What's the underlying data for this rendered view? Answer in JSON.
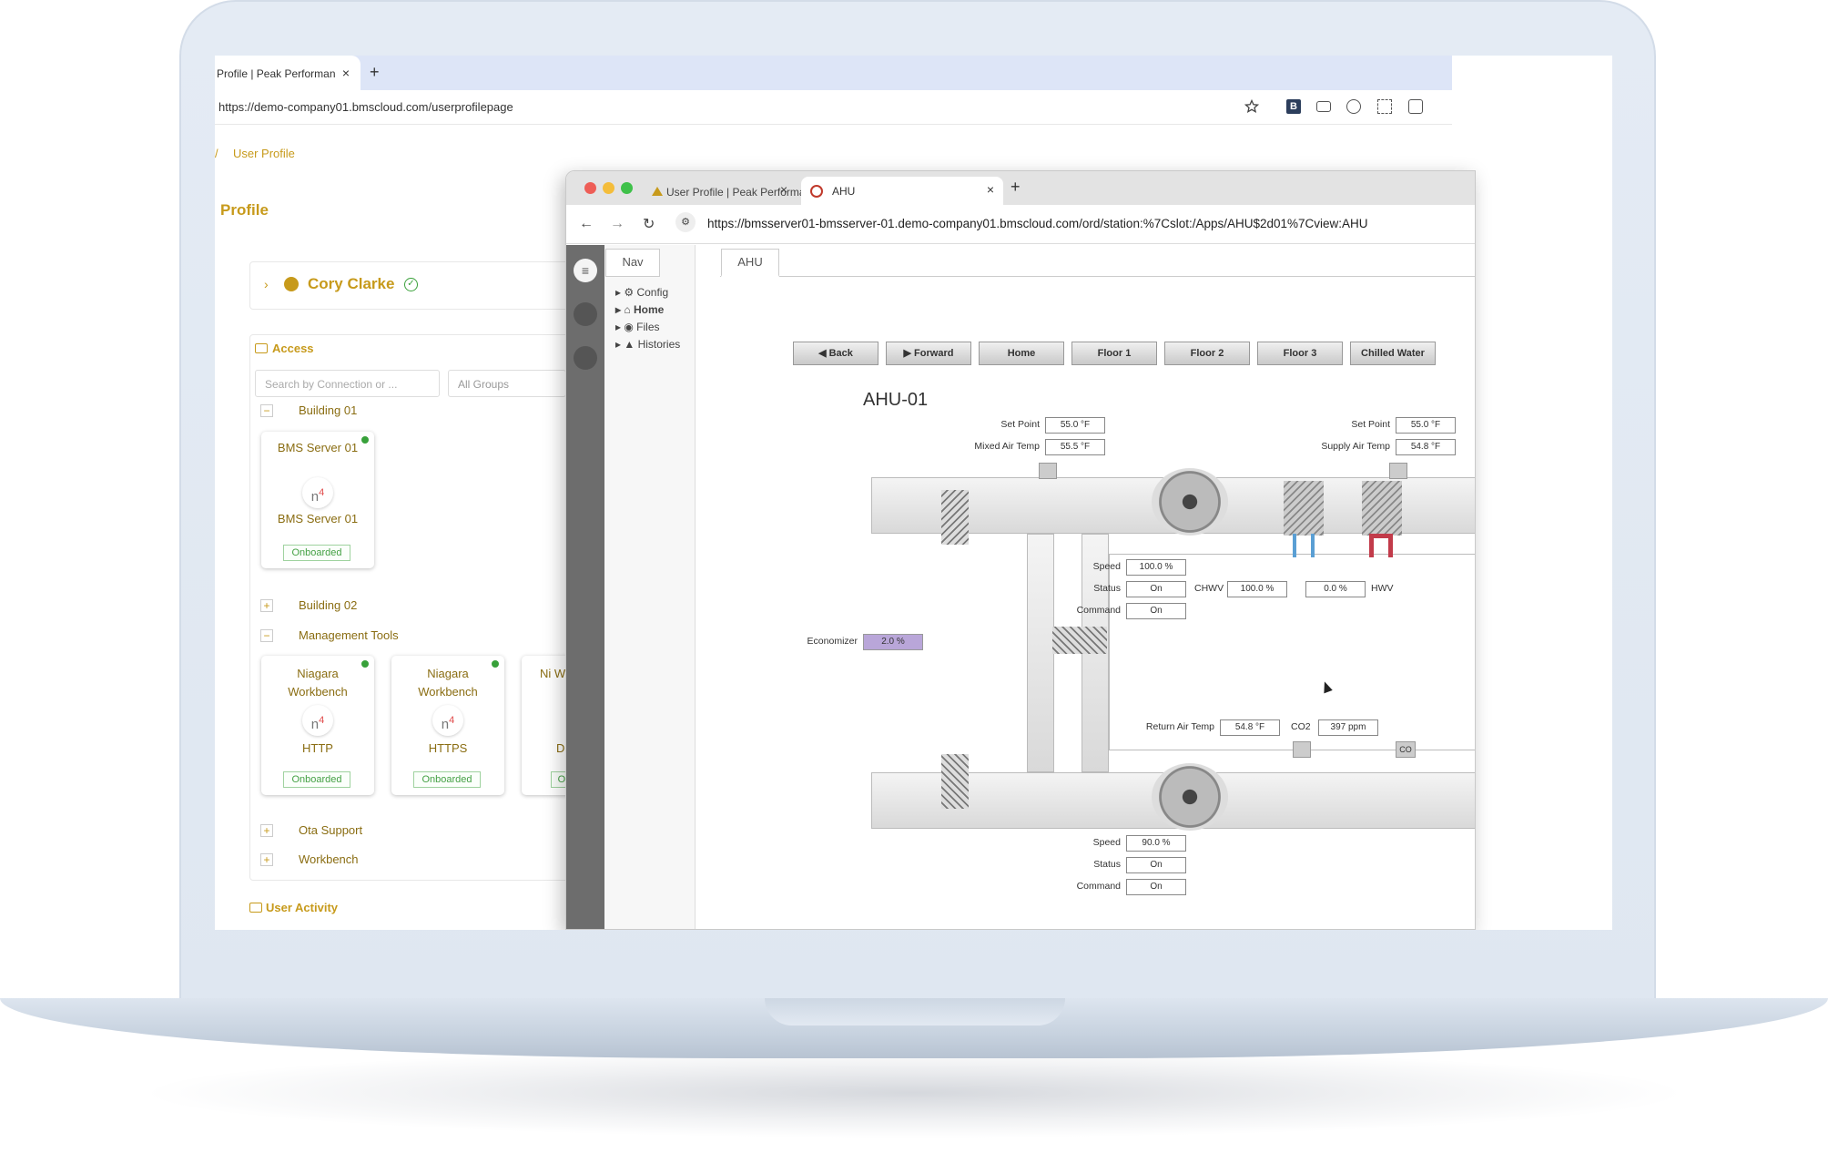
{
  "back_browser": {
    "tab_title": "Profile | Peak Performan",
    "tab_close": "×",
    "new_tab": "+",
    "url": "https://demo-company01.bmscloud.com/userprofilepage",
    "breadcrumb_sep": "/",
    "breadcrumb": "User Profile",
    "page_title": "Profile",
    "user_name": "Cory Clarke",
    "access_heading": "Access",
    "search_placeholder": "Search by Connection or ...",
    "group_select": "All Groups",
    "tree": [
      {
        "toggle": "−",
        "label": "Building 01"
      },
      {
        "toggle": "+",
        "label": "Building 02"
      },
      {
        "toggle": "−",
        "label": "Management Tools"
      },
      {
        "toggle": "+",
        "label": "Ota Support"
      },
      {
        "toggle": "+",
        "label": "Workbench"
      }
    ],
    "tiles": [
      {
        "title": "BMS Server 01",
        "logo": "n",
        "logo_sup": "4",
        "subtitle": "BMS Server 01",
        "badge": "Onboarded"
      },
      {
        "title": "Niagara Workbench",
        "logo": "n",
        "logo_sup": "4",
        "subtitle": "HTTP",
        "badge": "Onboarded"
      },
      {
        "title": "Niagara Workbench",
        "logo": "n",
        "logo_sup": "4",
        "subtitle": "HTTPS",
        "badge": "Onboarded"
      },
      {
        "title": "Ni Wor",
        "subtitle": "D",
        "badge": "On"
      }
    ],
    "user_activity": "User Activity"
  },
  "front_browser": {
    "tab1_title": "User Profile | Peak Performan",
    "tab1_close": "×",
    "tab2_title": "AHU",
    "tab2_close": "×",
    "new_tab": "+",
    "url": "https://bmsserver01-bmsserver-01.demo-company01.bmscloud.com/ord/station:%7Cslot:/Apps/AHU$2d01%7Cview:AHU",
    "nav_tab": "Nav",
    "nav_items": [
      "Config",
      "Home",
      "Files",
      "Histories"
    ],
    "view_tab": "AHU"
  },
  "ahu": {
    "buttons": [
      "Back",
      "Forward",
      "Home",
      "Floor 1",
      "Floor 2",
      "Floor 3",
      "Chilled Water"
    ],
    "title": "AHU-01",
    "mixed_setpoint_label": "Set Point",
    "mixed_setpoint": "55.0 °F",
    "mixed_air_label": "Mixed Air Temp",
    "mixed_air": "55.5 °F",
    "supply_setpoint_label": "Set Point",
    "supply_setpoint": "55.0 °F",
    "supply_air_label": "Supply Air Temp",
    "supply_air": "54.8 °F",
    "supply_fan": {
      "speed_label": "Speed",
      "speed": "100.0 %",
      "status_label": "Status",
      "status": "On",
      "command_label": "Command",
      "command": "On"
    },
    "chwv_label": "CHWV",
    "chwv": "100.0 %",
    "hwv": "0.0 %",
    "hwv_label": "HWV",
    "economizer_label": "Economizer",
    "economizer": "2.0 %",
    "economizer_fill": 0.02,
    "return_air_label": "Return Air Temp",
    "return_air": "54.8 °F",
    "co2_label": "CO2",
    "co2": "397 ppm",
    "co2_sensor": "CO",
    "return_fan": {
      "speed_label": "Speed",
      "speed": "90.0 %",
      "status_label": "Status",
      "status": "On",
      "command_label": "Command",
      "command": "On"
    }
  }
}
